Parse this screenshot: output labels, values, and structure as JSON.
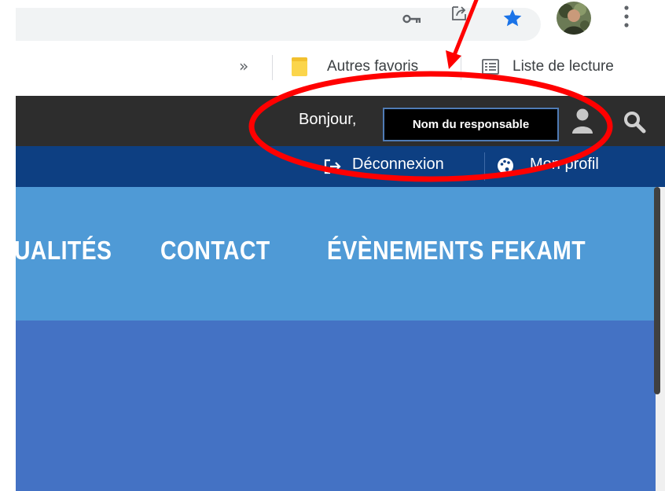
{
  "browser": {
    "icons": {
      "key": "key-icon",
      "share": "share-icon",
      "star": "star-icon",
      "avatar": "avatar",
      "menu": "kebab-menu-icon"
    },
    "bookmarks": {
      "chevron": "»",
      "folder_label": "Autres favoris",
      "reading_list_label": "Liste de lecture"
    }
  },
  "site": {
    "header": {
      "greeting": "Bonjour,",
      "user_name": "Nom du responsable"
    },
    "account": {
      "logout_label": "Déconnexion",
      "profile_label": "Mon profil"
    },
    "nav": [
      {
        "label": "UALITÉS"
      },
      {
        "label": "CONTACT"
      },
      {
        "label": "ÉVÈNEMENTS FEKAMT"
      }
    ]
  },
  "colors": {
    "accent_blue": "#1a73e8",
    "site_topbar": "#2d2d2d",
    "site_account_bar": "#0d3f82",
    "site_nav": "#4f9ad6",
    "site_hero": "#4472c4",
    "annotation_red": "#ff0000"
  }
}
